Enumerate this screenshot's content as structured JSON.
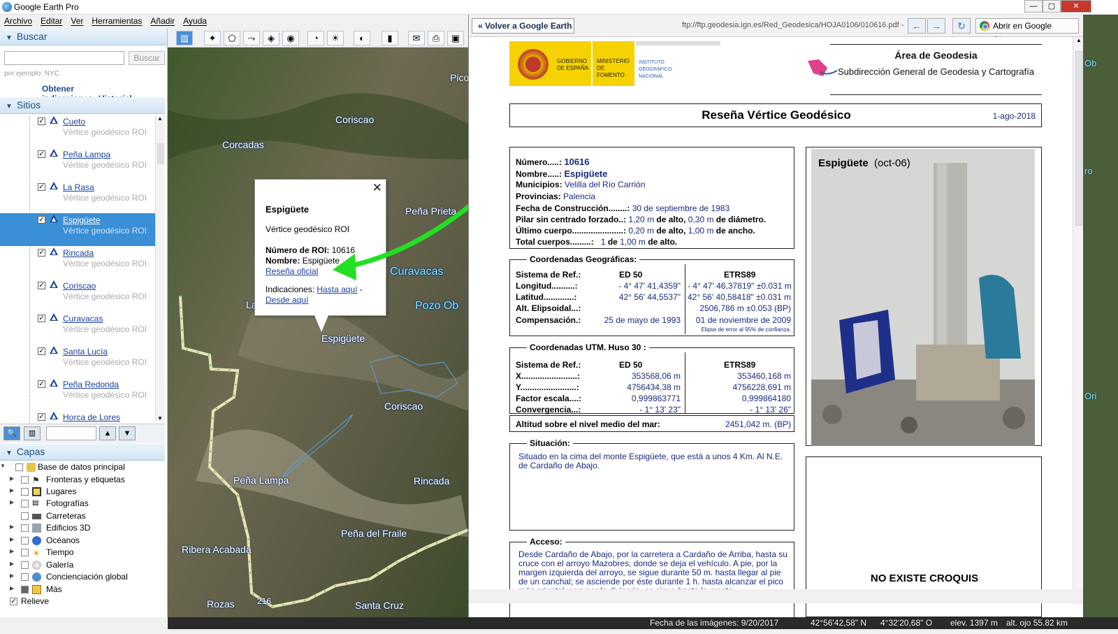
{
  "window": {
    "title": "Google Earth Pro"
  },
  "menu": [
    "Archivo",
    "Editar",
    "Ver",
    "Herramientas",
    "Añadir",
    "Ayuda"
  ],
  "search": {
    "header": "Buscar",
    "button": "Buscar",
    "placeholder": "",
    "hint": "por ejemplo: NYC",
    "directions": "Obtener indicaciones",
    "history": "Historial"
  },
  "places": {
    "header": "Sitios",
    "items": [
      {
        "name": "Cueto",
        "desc": "Vértice geodésico ROI"
      },
      {
        "name": "Peña Lampa",
        "desc": "Vértice geodésico ROI"
      },
      {
        "name": "La Rasa",
        "desc": "Vértice geodésico ROI"
      },
      {
        "name": "Espigüete",
        "desc": "Vértice geodésico ROI",
        "selected": true
      },
      {
        "name": "Rincada",
        "desc": "Vértice geodésico ROI"
      },
      {
        "name": "Coriscao",
        "desc": "Vértice geodésico ROI"
      },
      {
        "name": "Curavacas",
        "desc": "Vértice geodésico ROI"
      },
      {
        "name": "Santa Lucía",
        "desc": "Vértice geodésico ROI"
      },
      {
        "name": "Peña Redonda",
        "desc": "Vértice geodésico ROI"
      },
      {
        "name": "Horca de Lores",
        "desc": ""
      }
    ]
  },
  "layers": {
    "header": "Capas",
    "items": [
      {
        "name": "Base de datos principal",
        "icon": "database-icon"
      },
      {
        "name": "Fronteras y etiquetas",
        "icon": "flag-icon"
      },
      {
        "name": "Lugares",
        "icon": "places-icon"
      },
      {
        "name": "Fotografías",
        "icon": "photo-icon"
      },
      {
        "name": "Carreteras",
        "icon": "road-icon"
      },
      {
        "name": "Edificios 3D",
        "icon": "buildings-icon"
      },
      {
        "name": "Océanos",
        "icon": "ocean-icon"
      },
      {
        "name": "Tiempo",
        "icon": "weather-icon"
      },
      {
        "name": "Galería",
        "icon": "gallery-icon"
      },
      {
        "name": "Concienciación global",
        "icon": "globe-icon"
      },
      {
        "name": "Más",
        "icon": "more-icon"
      },
      {
        "name": "Relieve",
        "icon": "terrain-icon"
      }
    ]
  },
  "map": {
    "labels": [
      "Coriscao",
      "Corcadas",
      "Peña Prieta",
      "Curavacas",
      "Pozo Ob",
      "La",
      "Espigüete",
      "Coriscao",
      "Peña Lampa",
      "Rincada",
      "Peña del Fraile",
      "Ribera Acabada",
      "Rozas",
      "Santa Cruz",
      "Pico"
    ],
    "road": "216"
  },
  "popup": {
    "title": "Espigüete",
    "subtitle": "Vértice geodésico ROI",
    "roi_label": "Número de ROI:",
    "roi_value": "10616",
    "name_label": "Nombre:",
    "name_value": "Espigüete",
    "official_link": "Reseña oficial",
    "directions_label": "Indicaciones:",
    "to_here": "Hasta aquí",
    "dash": "-",
    "from_here": "Desde aquí",
    "close": "✕"
  },
  "browser": {
    "back": "Volver a Google Earth",
    "url": "ftp://ftp.geodesia.ign.es/Red_Geodesica/HOJA0106/010616.pdf -",
    "open_chrome": "Abrir en Google Chrome"
  },
  "pdf": {
    "logo_gov": "GOBIERNO DE ESPAÑA",
    "logo_min": "MINISTERIO DE FOMENTO",
    "logo_ign": "INSTITUTO GEOGRÁFICO NACIONAL",
    "area": "Área de Geodesia",
    "subdir": "Subdirección General de Geodesia y Cartografía",
    "title": "Reseña Vértice Geodésico",
    "date": "1-ago-2018",
    "numero_l": "Número.....:",
    "numero": "10616",
    "nombre_l": "Nombre.....:",
    "nombre": "Espigüete",
    "municipios_l": "Municipios:",
    "municipios": "Velilla del Río Carrión",
    "provincias_l": "Provincias:",
    "provincias": "Palencia",
    "fecha_l": "Fecha de Construcción........:",
    "fecha": "30 de septiembre de 1983",
    "pilar_l": "Pilar sin centrado forzado..:",
    "pilar_alto": "1,20 m",
    "de_alto": "de alto,",
    "pilar_diam": "0,30 m",
    "de_diam": "de diámetro.",
    "ultimo_l": "Último cuerpo......................:",
    "ultimo_alto": "0,20 m",
    "ultimo_ancho": "1,00 m",
    "de_ancho": "de ancho.",
    "total_l": "Total cuerpos.........:",
    "total_n": "1",
    "total_de": "de",
    "total_alto": "1,00 m",
    "de_alto2": "de alto.",
    "geo_caption": "Coordenadas Geográficas:",
    "sys_l": "Sistema de Ref.:",
    "ed50": "ED 50",
    "etrs": "ETRS89",
    "lon_l": "Longitud..........:",
    "lon_ed": "- 4° 47' 41,4359\"",
    "lon_et": "- 4° 47' 46,37819\" ±0.031 m",
    "lat_l": "Latitud.............:",
    "lat_ed": "42° 56' 44,5537\"",
    "lat_et": "42° 56' 40,58418\" ±0.031 m",
    "alt_l": "Alt. Elipsoidal...:",
    "alt_et": "2506,786 m ±0.053 (BP)",
    "comp_l": "Compensación.:",
    "comp_ed": "25 de mayo de 1993",
    "comp_et": "01 de noviembre de 2009",
    "elipse": "Elipse de error al 95% de confianza.",
    "utm_caption": "Coordenadas UTM. Huso  30 :",
    "x_l": "X........................:",
    "x_ed": "353568,06 m",
    "x_et": "353460,168 m",
    "y_l": "Y........................:",
    "y_ed": "4756434,38 m",
    "y_et": "4756228,691 m",
    "fe_l": "Factor escala....:",
    "fe_ed": "0,999863771",
    "fe_et": "0,999864180",
    "conv_l": "Convergencia...:",
    "conv_ed": "- 1° 13' 23\"",
    "conv_et": "- 1° 13' 26\"",
    "altmar_l": "Altitud sobre el nivel medio del mar:",
    "altmar": "2451,042 m. (BP)",
    "sit_caption": "Situación:",
    "situacion": "Situado en la cima del monte Espigüete, que está a unos 4 Km. Al N.E. de Cardaño de Abajo.",
    "acc_caption": "Acceso:",
    "acceso": "Desde Cardaño de Abajo, por la carretera a Cardaño de Arriba, hasta su cruce con el arroyo Mazobres, donde se deja el vehículo. A pie, por la margen izquierda del arroyo, se sigue durante 50 m. hasta llegar al pie de un canchal; se asciende por éste durante 1 h. hasta alcanzar el pico más oriental y, va por la divisoria, se sigue hasta la cresta",
    "photo_title": "Espigüete",
    "photo_date": "(oct-06)",
    "croquis": "NO EXISTE CROQUIS"
  },
  "status": {
    "date": "Fecha de las imágenes: 9/20/2017",
    "lat": "42°56'42,58\" N",
    "lon": "4°32'20,68\" O",
    "elev": "elev.  1397 m",
    "eye": "alt. ojo  55.82 km"
  },
  "rightmap": [
    "Ob",
    "ro",
    "Ori"
  ],
  "colors": {
    "accent": "#3a8fd6",
    "arrow": "#22e022",
    "track": "#2cbf2c"
  }
}
